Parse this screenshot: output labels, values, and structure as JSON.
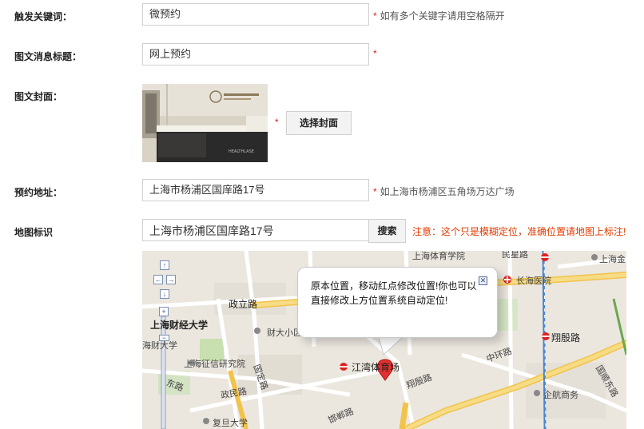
{
  "form": {
    "keyword": {
      "label": "触发关键词：",
      "value": "微预约",
      "hint": "如有多个关键字请用空格隔开"
    },
    "title": {
      "label": "图文消息标题：",
      "value": "网上预约"
    },
    "cover": {
      "label": "图文封面：",
      "button": "选择封面",
      "image_text": "HEALTHLASE"
    },
    "address": {
      "label": "预约地址：",
      "value": "上海市杨浦区国庠路17号",
      "hint": "如上海市杨浦区五角场万达广场"
    },
    "map_marker": {
      "label": "地图标识",
      "value": "上海市杨浦区国庠路17号",
      "button": "搜索",
      "notice": "注意：这个只是模糊定位，准确位置请地图上标注!"
    },
    "required_mark": "*"
  },
  "map": {
    "popup_text": "原本位置，移动红点修改位置!你也可以直接修改上方位置系统自动定位!",
    "labels": {
      "sports_school": "上海体育学院",
      "minxing": "民星路",
      "changhai": "长海医院",
      "shangjin": "上海金",
      "zhengli": "政立路",
      "university": "上海财经大学",
      "caida": "财大小区",
      "haicai": "海财大学",
      "credit": "上海征信研究院",
      "zhengmin": "政民路",
      "guoding": "国定路",
      "dongfeng": "东路",
      "jiangwan": "江湾体育场",
      "xiangyin": "翔殷路",
      "xiangyin_metro": "翔殷路",
      "zhonghuan": "中环路",
      "qihang": "企航商务",
      "guoshun": "国顺东路",
      "handan": "邯郸路",
      "fudan": "复旦大学"
    },
    "zoom": {
      "plus": "+",
      "minus": "−"
    }
  }
}
